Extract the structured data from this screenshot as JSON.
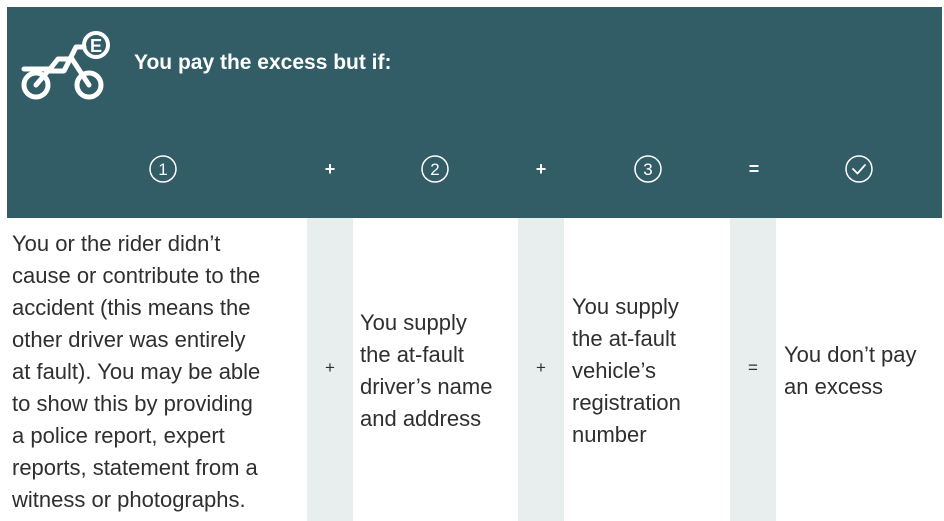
{
  "header": {
    "title": "You pay the excess but if:",
    "badge_letter": "E",
    "steps": [
      "1",
      "2",
      "3"
    ],
    "operators": [
      "+",
      "+",
      "="
    ]
  },
  "body": {
    "col1": [
      "You or the rider didn’t",
      "cause or contribute to the",
      "accident (this means the",
      "other driver was entirely",
      "at fault). You may be able",
      "to show this by providing",
      "a police report, expert",
      "reports, statement from a",
      "witness or photographs."
    ],
    "col2": [
      "You supply",
      "the at-fault",
      "driver’s name",
      "and address"
    ],
    "col3": [
      "You supply",
      "the at-fault",
      "vehicle’s",
      "registration",
      "number"
    ],
    "col4": [
      "You don’t pay",
      "an excess"
    ],
    "operators": [
      "+",
      "+",
      "="
    ]
  },
  "colors": {
    "header": "#325c66",
    "band": "#e8eeee",
    "text": "#2f2f2f"
  }
}
